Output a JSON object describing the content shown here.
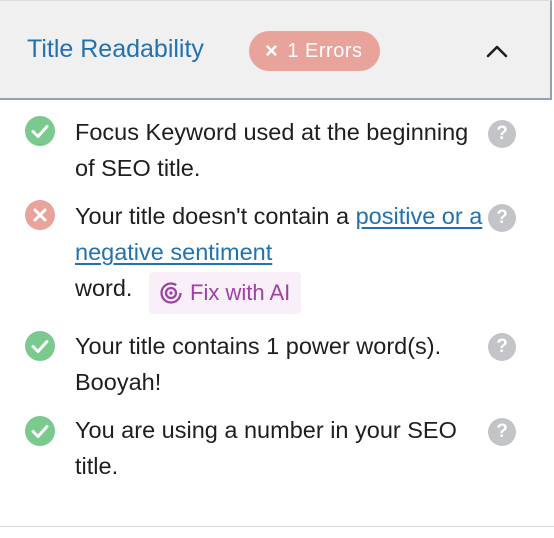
{
  "header": {
    "title": "Title Readability",
    "badge_label": "1 Errors",
    "badge_icon": "close-icon",
    "toggle_icon": "chevron-up-icon"
  },
  "checks": [
    {
      "status": "pass",
      "text": "Focus Keyword used at the beginning of SEO title.",
      "help_label": "?"
    },
    {
      "status": "fail",
      "text_before": "Your title doesn't contain a",
      "link_text": "positive or a negative sentiment",
      "text_after": "word.",
      "fix_button_label": "Fix with AI",
      "help_label": "?"
    },
    {
      "status": "pass",
      "text": "Your title contains 1 power word(s). Booyah!",
      "help_label": "?"
    },
    {
      "status": "pass",
      "text": "You are using a number in your SEO title.",
      "help_label": "?"
    }
  ],
  "colors": {
    "accent_blue": "#2271b1",
    "pass_green": "#7ac98f",
    "error_red": "#e8a39b",
    "ai_purple": "#9e3fa5",
    "help_gray": "#c3c4c7"
  }
}
